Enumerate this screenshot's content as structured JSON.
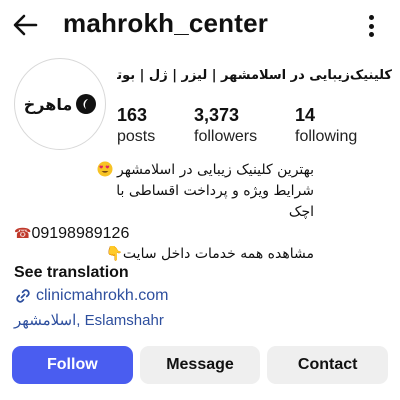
{
  "header": {
    "username": "mahrokh_center",
    "back_icon": "arrow-left-icon",
    "more_icon": "vertical-ellipsis-icon"
  },
  "profile": {
    "avatar_logo_text": "ماهرخ",
    "category": "کلینیک‌زیبایی در اسلامشهر | لیزر | ژل | بوتاکس",
    "stats": [
      {
        "value": "163",
        "label": "posts"
      },
      {
        "value": "3,373",
        "label": "followers"
      },
      {
        "value": "14",
        "label": "following"
      }
    ]
  },
  "bio": {
    "line1": "بهترین کلینیک زیبایی در اسلامشهر",
    "line2": "شرایط ویژه و پرداخت اقساطی با",
    "line3": "اچک",
    "phone": "09198989126",
    "phone_icon": "☎",
    "line5": "مشاهده همه خدمات داخل سایت",
    "point_icon": "👇",
    "see_translation": "See translation",
    "link": "clinicmahrokh.com",
    "location": "اسلامشهر, Eslamshahr"
  },
  "actions": {
    "follow": "Follow",
    "message": "Message",
    "contact": "Contact"
  },
  "colors": {
    "accent": "#4a5df0",
    "link": "#2e4f9e",
    "button_secondary": "#efefef"
  }
}
